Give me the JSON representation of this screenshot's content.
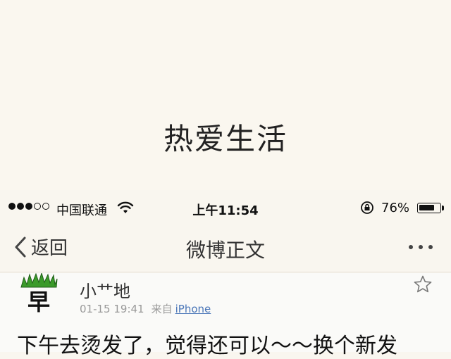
{
  "banner": {
    "title": "热爱生活"
  },
  "status_bar": {
    "signal_bars_filled": 3,
    "signal_bars_total": 5,
    "carrier": "中国联通",
    "time": "上午11:54",
    "battery_percent": "76%",
    "battery_level": 0.76
  },
  "navbar": {
    "back_label": "返回",
    "title": "微博正文"
  },
  "post": {
    "avatar_char": "早",
    "username": "小艹地",
    "timestamp": "01-15 19:41",
    "source_label": "来自",
    "source_link": "iPhone",
    "text": "下午去烫发了，觉得还可以～～换个新发"
  },
  "colors": {
    "background": "#faf7ef",
    "link": "#4a76b8",
    "avatar_grass": "#3a9a2a"
  }
}
